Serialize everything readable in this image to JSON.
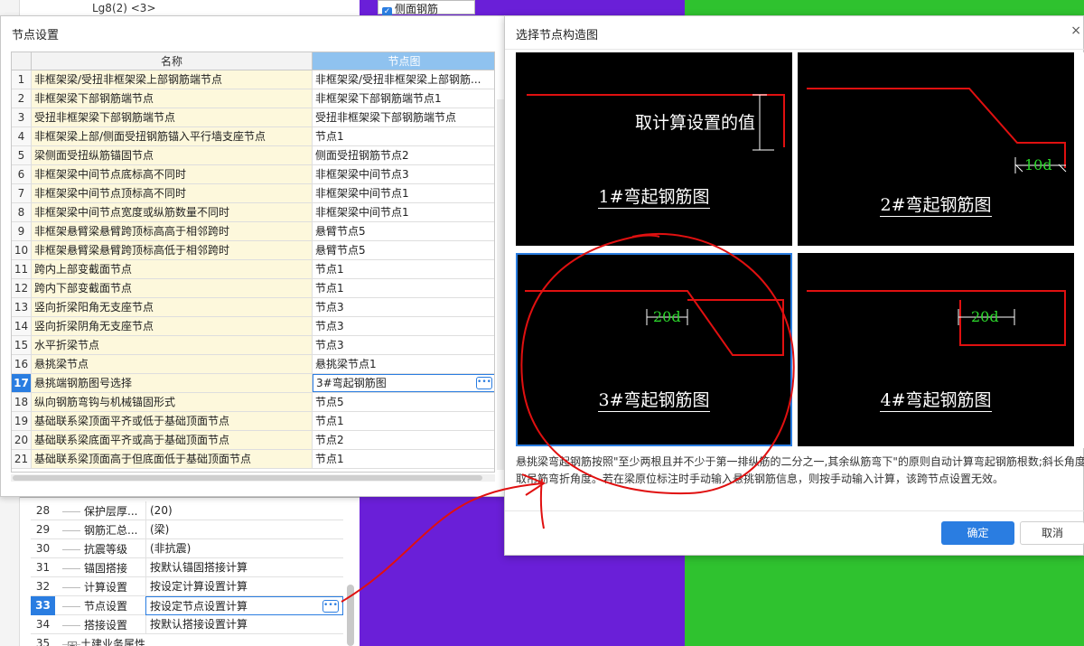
{
  "background": {
    "tree_top_text": "Lg8(2) <3>",
    "side_checkbox_label": "侧面钢筋",
    "properties": [
      {
        "num": "28",
        "name": "保护层厚...",
        "value": "(20)"
      },
      {
        "num": "29",
        "name": "钢筋汇总...",
        "value": "(梁)"
      },
      {
        "num": "30",
        "name": "抗震等级",
        "value": "(非抗震)"
      },
      {
        "num": "31",
        "name": "锚固搭接",
        "value": "按默认锚固搭接计算"
      },
      {
        "num": "32",
        "name": "计算设置",
        "value": "按设定计算设置计算"
      },
      {
        "num": "33",
        "name": "节点设置",
        "value": "按设定节点设置计算"
      },
      {
        "num": "34",
        "name": "搭接设置",
        "value": "按默认搭接设置计算"
      },
      {
        "num": "35",
        "name": "土建业务属性",
        "value": ""
      }
    ],
    "selected_property": "33"
  },
  "node_dialog": {
    "title": "节点设置",
    "headers": {
      "name": "名称",
      "node": "节点图"
    },
    "rows": [
      {
        "num": "1",
        "name": "非框架梁/受扭非框架梁上部钢筋端节点",
        "node": "非框架梁/受扭非框架梁上部钢筋..."
      },
      {
        "num": "2",
        "name": "非框架梁下部钢筋端节点",
        "node": "非框架梁下部钢筋端节点1"
      },
      {
        "num": "3",
        "name": "受扭非框架梁下部钢筋端节点",
        "node": "受扭非框架梁下部钢筋端节点"
      },
      {
        "num": "4",
        "name": "非框架梁上部/侧面受扭钢筋锚入平行墙支座节点",
        "node": "节点1"
      },
      {
        "num": "5",
        "name": "梁侧面受扭纵筋锚固节点",
        "node": "侧面受扭钢筋节点2"
      },
      {
        "num": "6",
        "name": "非框架梁中间节点底标高不同时",
        "node": "非框架梁中间节点3"
      },
      {
        "num": "7",
        "name": "非框架梁中间节点顶标高不同时",
        "node": "非框架梁中间节点1"
      },
      {
        "num": "8",
        "name": "非框架梁中间节点宽度或纵筋数量不同时",
        "node": "非框架梁中间节点1"
      },
      {
        "num": "9",
        "name": "非框架悬臂梁悬臂跨顶标高高于相邻跨时",
        "node": "悬臂节点5"
      },
      {
        "num": "10",
        "name": "非框架悬臂梁悬臂跨顶标高低于相邻跨时",
        "node": "悬臂节点5"
      },
      {
        "num": "11",
        "name": "跨内上部变截面节点",
        "node": "节点1"
      },
      {
        "num": "12",
        "name": "跨内下部变截面节点",
        "node": "节点1"
      },
      {
        "num": "13",
        "name": "竖向折梁阳角无支座节点",
        "node": "节点3"
      },
      {
        "num": "14",
        "name": "竖向折梁阴角无支座节点",
        "node": "节点3"
      },
      {
        "num": "15",
        "name": "水平折梁节点",
        "node": "节点3"
      },
      {
        "num": "16",
        "name": "悬挑梁节点",
        "node": "悬挑梁节点1"
      },
      {
        "num": "17",
        "name": "悬挑端钢筋图号选择",
        "node": "3#弯起钢筋图"
      },
      {
        "num": "18",
        "name": "纵向钢筋弯钩与机械锚固形式",
        "node": "节点5"
      },
      {
        "num": "19",
        "name": "基础联系梁顶面平齐或低于基础顶面节点",
        "node": "节点1"
      },
      {
        "num": "20",
        "name": "基础联系梁底面平齐或高于基础顶面节点",
        "node": "节点2"
      },
      {
        "num": "21",
        "name": "基础联系梁顶面高于但底面低于基础顶面节点",
        "node": "节点1"
      }
    ],
    "selected_row": "17"
  },
  "figure_dialog": {
    "title": "选择节点构造图",
    "close_symbol": "×",
    "figures": [
      {
        "caption": "1#弯起钢筋图",
        "note": "取计算设置的值",
        "dim": ""
      },
      {
        "caption": "2#弯起钢筋图",
        "note": "",
        "dim": "10d"
      },
      {
        "caption": "3#弯起钢筋图",
        "note": "",
        "dim": "20d"
      },
      {
        "caption": "4#弯起钢筋图",
        "note": "",
        "dim": "20d"
      }
    ],
    "selected_figure": "3#弯起钢筋图",
    "description_line1": "悬挑梁弯起钢筋按照\"至少两根且并不少于第一排纵筋的二分之一,其余纵筋弯下\"的原则自动计算弯起钢筋根数;斜长角度",
    "description_line2": "取吊筋弯折角度。若在梁原位标注时手动输入悬挑钢筋信息，则按手动输入计算，该跨节点设置无效。",
    "ok_label": "确定",
    "cancel_label": "取消"
  },
  "colors": {
    "accent": "#2a7de1",
    "rebar_red": "#e01010",
    "dimension_green": "#2bd82b",
    "annotation_red": "#e01010",
    "viewport_purple": "#6a1fd8",
    "viewport_green": "#2fc22f",
    "name_cell_bg": "#fdf8dc",
    "header_node_bg": "#8fc2ef"
  },
  "icons": {
    "more": "ellipsis-icon",
    "close": "close-icon",
    "checkbox": "checkbox-checked-icon"
  }
}
